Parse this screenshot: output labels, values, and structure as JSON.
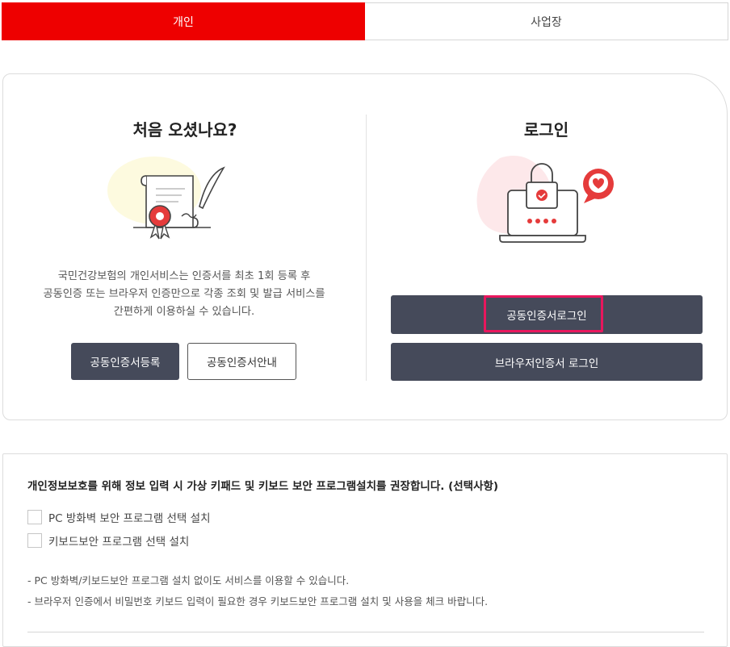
{
  "tabs": [
    {
      "label": "개인",
      "active": true
    },
    {
      "label": "사업장",
      "active": false
    }
  ],
  "left_panel": {
    "title": "처음 오셨나요?",
    "description_lines": [
      "국민건강보험의 개인서비스는 인증서를 최초 1회 등록 후",
      "공동인증 또는 브라우저 인증만으로 각종 조회 및 발급 서비스를",
      "간편하게 이용하실 수 있습니다."
    ],
    "register_button": "공동인증서등록",
    "guide_button": "공동인증서안내",
    "illustration_icon": "certificate-document-icon"
  },
  "right_panel": {
    "title": "로그인",
    "cert_login_button": "공동인증서로그인",
    "browser_login_button": "브라우저인증서 로그인",
    "illustration_icon": "laptop-lock-icon"
  },
  "security": {
    "title": "개인정보보호를 위해 정보 입력 시 가상 키패드 및 키보드 보안 프로그램설치를 권장합니다. (선택사항)",
    "options": [
      {
        "label": "PC 방화벽 보안 프로그램 선택 설치",
        "checked": false
      },
      {
        "label": "키보드보안 프로그램 선택 설치",
        "checked": false
      }
    ],
    "notes": [
      "- PC 방화벽/키보드보안 프로그램 설치 없이도 서비스를 이용할 수 있습니다.",
      "- 브라우저 인증에서 비밀번호 키보드 입력이 필요한 경우 키보드보안 프로그램 설치 및 사용을 체크 바랍니다."
    ]
  },
  "colors": {
    "brand_red": "#ee0000",
    "button_dark": "#454a5a",
    "highlight": "#e8175d"
  }
}
